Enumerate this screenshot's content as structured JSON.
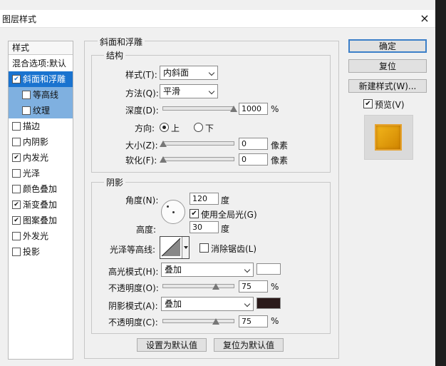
{
  "window": {
    "title": "图层样式",
    "close_glyph": "×"
  },
  "style_list": {
    "header": "样式",
    "items": [
      {
        "label": "混合选项:默认",
        "checkbox": false,
        "checked": false
      },
      {
        "label": "斜面和浮雕",
        "checkbox": true,
        "checked": true,
        "selected": true
      },
      {
        "label": "等高线",
        "checkbox": true,
        "checked": false,
        "sub": true
      },
      {
        "label": "纹理",
        "checkbox": true,
        "checked": false,
        "sub": true
      },
      {
        "label": "描边",
        "checkbox": true,
        "checked": false
      },
      {
        "label": "内阴影",
        "checkbox": true,
        "checked": false
      },
      {
        "label": "内发光",
        "checkbox": true,
        "checked": true
      },
      {
        "label": "光泽",
        "checkbox": true,
        "checked": false
      },
      {
        "label": "颜色叠加",
        "checkbox": true,
        "checked": false
      },
      {
        "label": "渐变叠加",
        "checkbox": true,
        "checked": true
      },
      {
        "label": "图案叠加",
        "checkbox": true,
        "checked": true
      },
      {
        "label": "外发光",
        "checkbox": true,
        "checked": false
      },
      {
        "label": "投影",
        "checkbox": true,
        "checked": false
      }
    ]
  },
  "bevel": {
    "title": "斜面和浮雕",
    "structure": {
      "title": "结构",
      "style_label": "样式(T):",
      "style_value": "内斜面",
      "technique_label": "方法(Q):",
      "technique_value": "平滑",
      "depth_label": "深度(D):",
      "depth_value": "1000",
      "depth_unit": "%",
      "depth_fraction": 1.0,
      "direction_label": "方向:",
      "dir_up": "上",
      "dir_down": "下",
      "direction_selected": "上",
      "size_label": "大小(Z):",
      "size_value": "0",
      "size_unit": "像素",
      "size_fraction": 0.0,
      "soften_label": "软化(F):",
      "soften_value": "0",
      "soften_unit": "像素",
      "soften_fraction": 0.0
    },
    "shading": {
      "title": "阴影",
      "angle_label": "角度(N):",
      "angle_value": "120",
      "angle_unit": "度",
      "global_light_label": "使用全局光(G)",
      "global_light_checked": true,
      "altitude_label": "高度:",
      "altitude_value": "30",
      "altitude_unit": "度",
      "gloss_label": "光泽等高线:",
      "antialias_label": "消除锯齿(L)",
      "antialias_checked": false,
      "highlight_mode_label": "高光模式(H):",
      "highlight_mode_value": "叠加",
      "highlight_color": "#ffffff",
      "highlight_opacity_label": "不透明度(O):",
      "highlight_opacity_value": "75",
      "highlight_opacity_unit": "%",
      "highlight_opacity_fraction": 0.75,
      "shadow_mode_label": "阴影模式(A):",
      "shadow_mode_value": "叠加",
      "shadow_color": "#2b1a1a",
      "shadow_opacity_label": "不透明度(C):",
      "shadow_opacity_value": "75",
      "shadow_opacity_unit": "%",
      "shadow_opacity_fraction": 0.75
    },
    "make_default": "设置为默认值",
    "reset_default": "复位为默认值"
  },
  "buttons": {
    "ok": "确定",
    "reset": "复位",
    "new_style": "新建样式(W)...",
    "preview_label": "预览(V)",
    "preview_checked": true
  }
}
